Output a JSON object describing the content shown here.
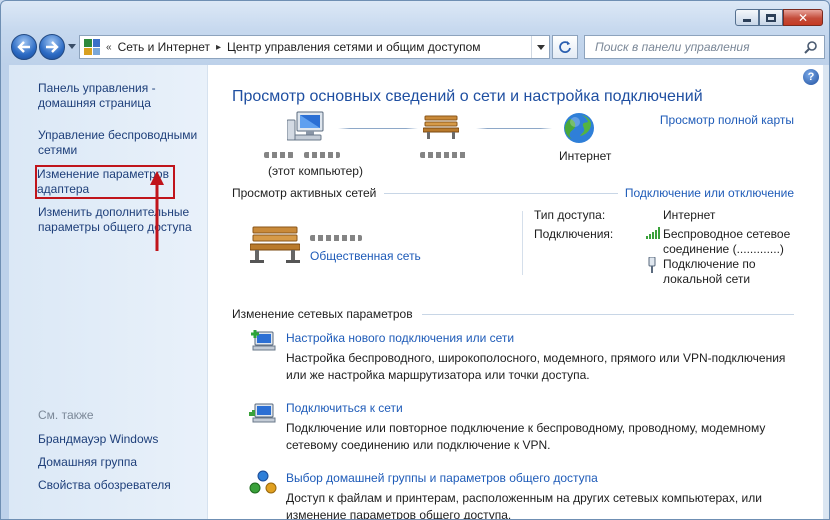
{
  "window": {
    "minimize_label": "minimize",
    "maximize_label": "maximize",
    "close_label": "close"
  },
  "nav": {
    "breadcrumb": [
      "Сеть и Интернет",
      "Центр управления сетями и общим доступом"
    ],
    "search_placeholder": "Поиск в панели управления"
  },
  "sidebar": {
    "items": [
      "Панель управления - домашняя страница",
      "Управление беспроводными сетями",
      "Изменение параметров адаптера",
      "Изменить дополнительные параметры общего доступа"
    ],
    "see_also_label": "См. также",
    "see_also": [
      "Брандмауэр Windows",
      "Домашняя группа",
      "Свойства обозревателя"
    ]
  },
  "main": {
    "title": "Просмотр основных сведений о сети и настройка подключений",
    "full_map_link": "Просмотр полной карты",
    "map": {
      "computer_caption": "(этот компьютер)",
      "internet_label": "Интернет"
    },
    "active": {
      "heading": "Просмотр активных сетей",
      "connect_link": "Подключение или отключение",
      "network_type_link": "Общественная сеть",
      "access_type_label": "Тип доступа:",
      "access_type_value": "Интернет",
      "connections_label": "Подключения:",
      "wireless_conn": "Беспроводное сетевое соединение",
      "wireless_suffix": "(.............)",
      "lan_conn": "Подключение по локальной сети"
    },
    "change": {
      "heading": "Изменение сетевых параметров",
      "tasks": [
        {
          "title": "Настройка нового подключения или сети",
          "desc": "Настройка беспроводного, широкополосного, модемного, прямого или VPN-подключения или же настройка маршрутизатора или точки доступа."
        },
        {
          "title": "Подключиться к сети",
          "desc": "Подключение или повторное подключение к беспроводному, проводному, модемному сетевому соединению или подключение к VPN."
        },
        {
          "title": "Выбор домашней группы и параметров общего доступа",
          "desc": "Доступ к файлам и принтерам, расположенным на других сетевых компьютерах, или изменение параметров общего доступа."
        }
      ]
    }
  },
  "colors": {
    "link": "#1e5bb8",
    "title": "#1f4fa1",
    "highlight": "#c0141b"
  }
}
